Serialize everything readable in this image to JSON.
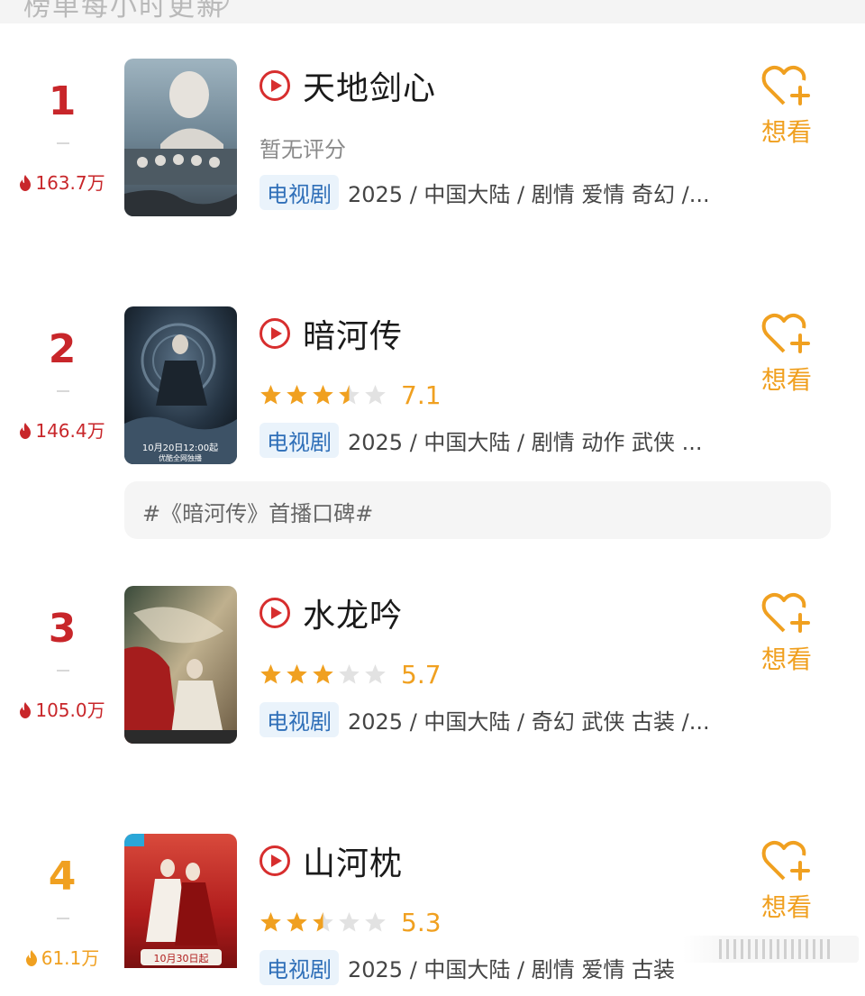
{
  "header": {
    "hint": "榜单每小时更新"
  },
  "items": [
    {
      "rank": "1",
      "heat": "163.7万",
      "title": "天地剑心",
      "rating_text": "暂无评分",
      "score": "",
      "stars": 0,
      "tag": "电视剧",
      "meta": "2025 / 中国大陆 / 剧情 爱情 奇幻 /...",
      "want_label": "想看",
      "rank_color": "#c8262a"
    },
    {
      "rank": "2",
      "heat": "146.4万",
      "title": "暗河传",
      "rating_text": "",
      "score": "7.1",
      "stars": 3.5,
      "tag": "电视剧",
      "meta": "2025 / 中国大陆 / 剧情 动作 武侠 ...",
      "want_label": "想看",
      "rank_color": "#c8262a"
    },
    {
      "rank": "3",
      "heat": "105.0万",
      "title": "水龙吟",
      "rating_text": "",
      "score": "5.7",
      "stars": 3,
      "tag": "电视剧",
      "meta": "2025 / 中国大陆 / 奇幻 武侠 古装 /...",
      "want_label": "想看",
      "rank_color": "#c8262a"
    },
    {
      "rank": "4",
      "heat": "61.1万",
      "title": "山河枕",
      "rating_text": "",
      "score": "5.3",
      "stars": 2.5,
      "tag": "电视剧",
      "meta": "2025 / 中国大陆 / 剧情 爱情 古装",
      "want_label": "想看",
      "rank_color": "#f0a020"
    }
  ],
  "topic": {
    "text": "#《暗河传》首播口碑#"
  },
  "poster_captions": {
    "item2": "10月20日12:00起",
    "item2_sub": "优酷全网独播",
    "item4": "10月30日起"
  },
  "colors": {
    "accent_red": "#c8262a",
    "accent_orange": "#f0a020",
    "tag_bg": "#eaf3fb",
    "tag_text": "#2f6fb8"
  }
}
